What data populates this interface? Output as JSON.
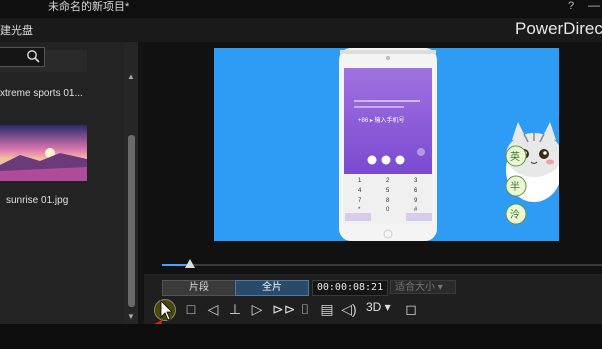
{
  "window": {
    "project_title": "未命名的新项目*",
    "help": "?",
    "minimize": "—",
    "brand": "PowerDirector"
  },
  "toolbar": {
    "disc_label": "建光盘"
  },
  "library": {
    "items": [
      {
        "label": "xtreme sports 01..."
      },
      {
        "label": "sunrise 01.jpg"
      }
    ]
  },
  "preview": {
    "phone_screen": {
      "prompt": "+86 ▸ 输入手机号",
      "keys": [
        "1",
        "2",
        "3",
        "4",
        "5",
        "6",
        "7",
        "8",
        "9",
        "*",
        "0",
        "#"
      ]
    },
    "sticker_text": [
      "英",
      "半",
      "泠"
    ]
  },
  "controls": {
    "segment_label": "片段",
    "full_label": "全片",
    "timecode": "00:00:08:21",
    "ratio_label": "适合大小",
    "threed_label": "3D"
  },
  "colors": {
    "video_bg": "#2e9bf5",
    "accent": "#4aa3ff"
  }
}
